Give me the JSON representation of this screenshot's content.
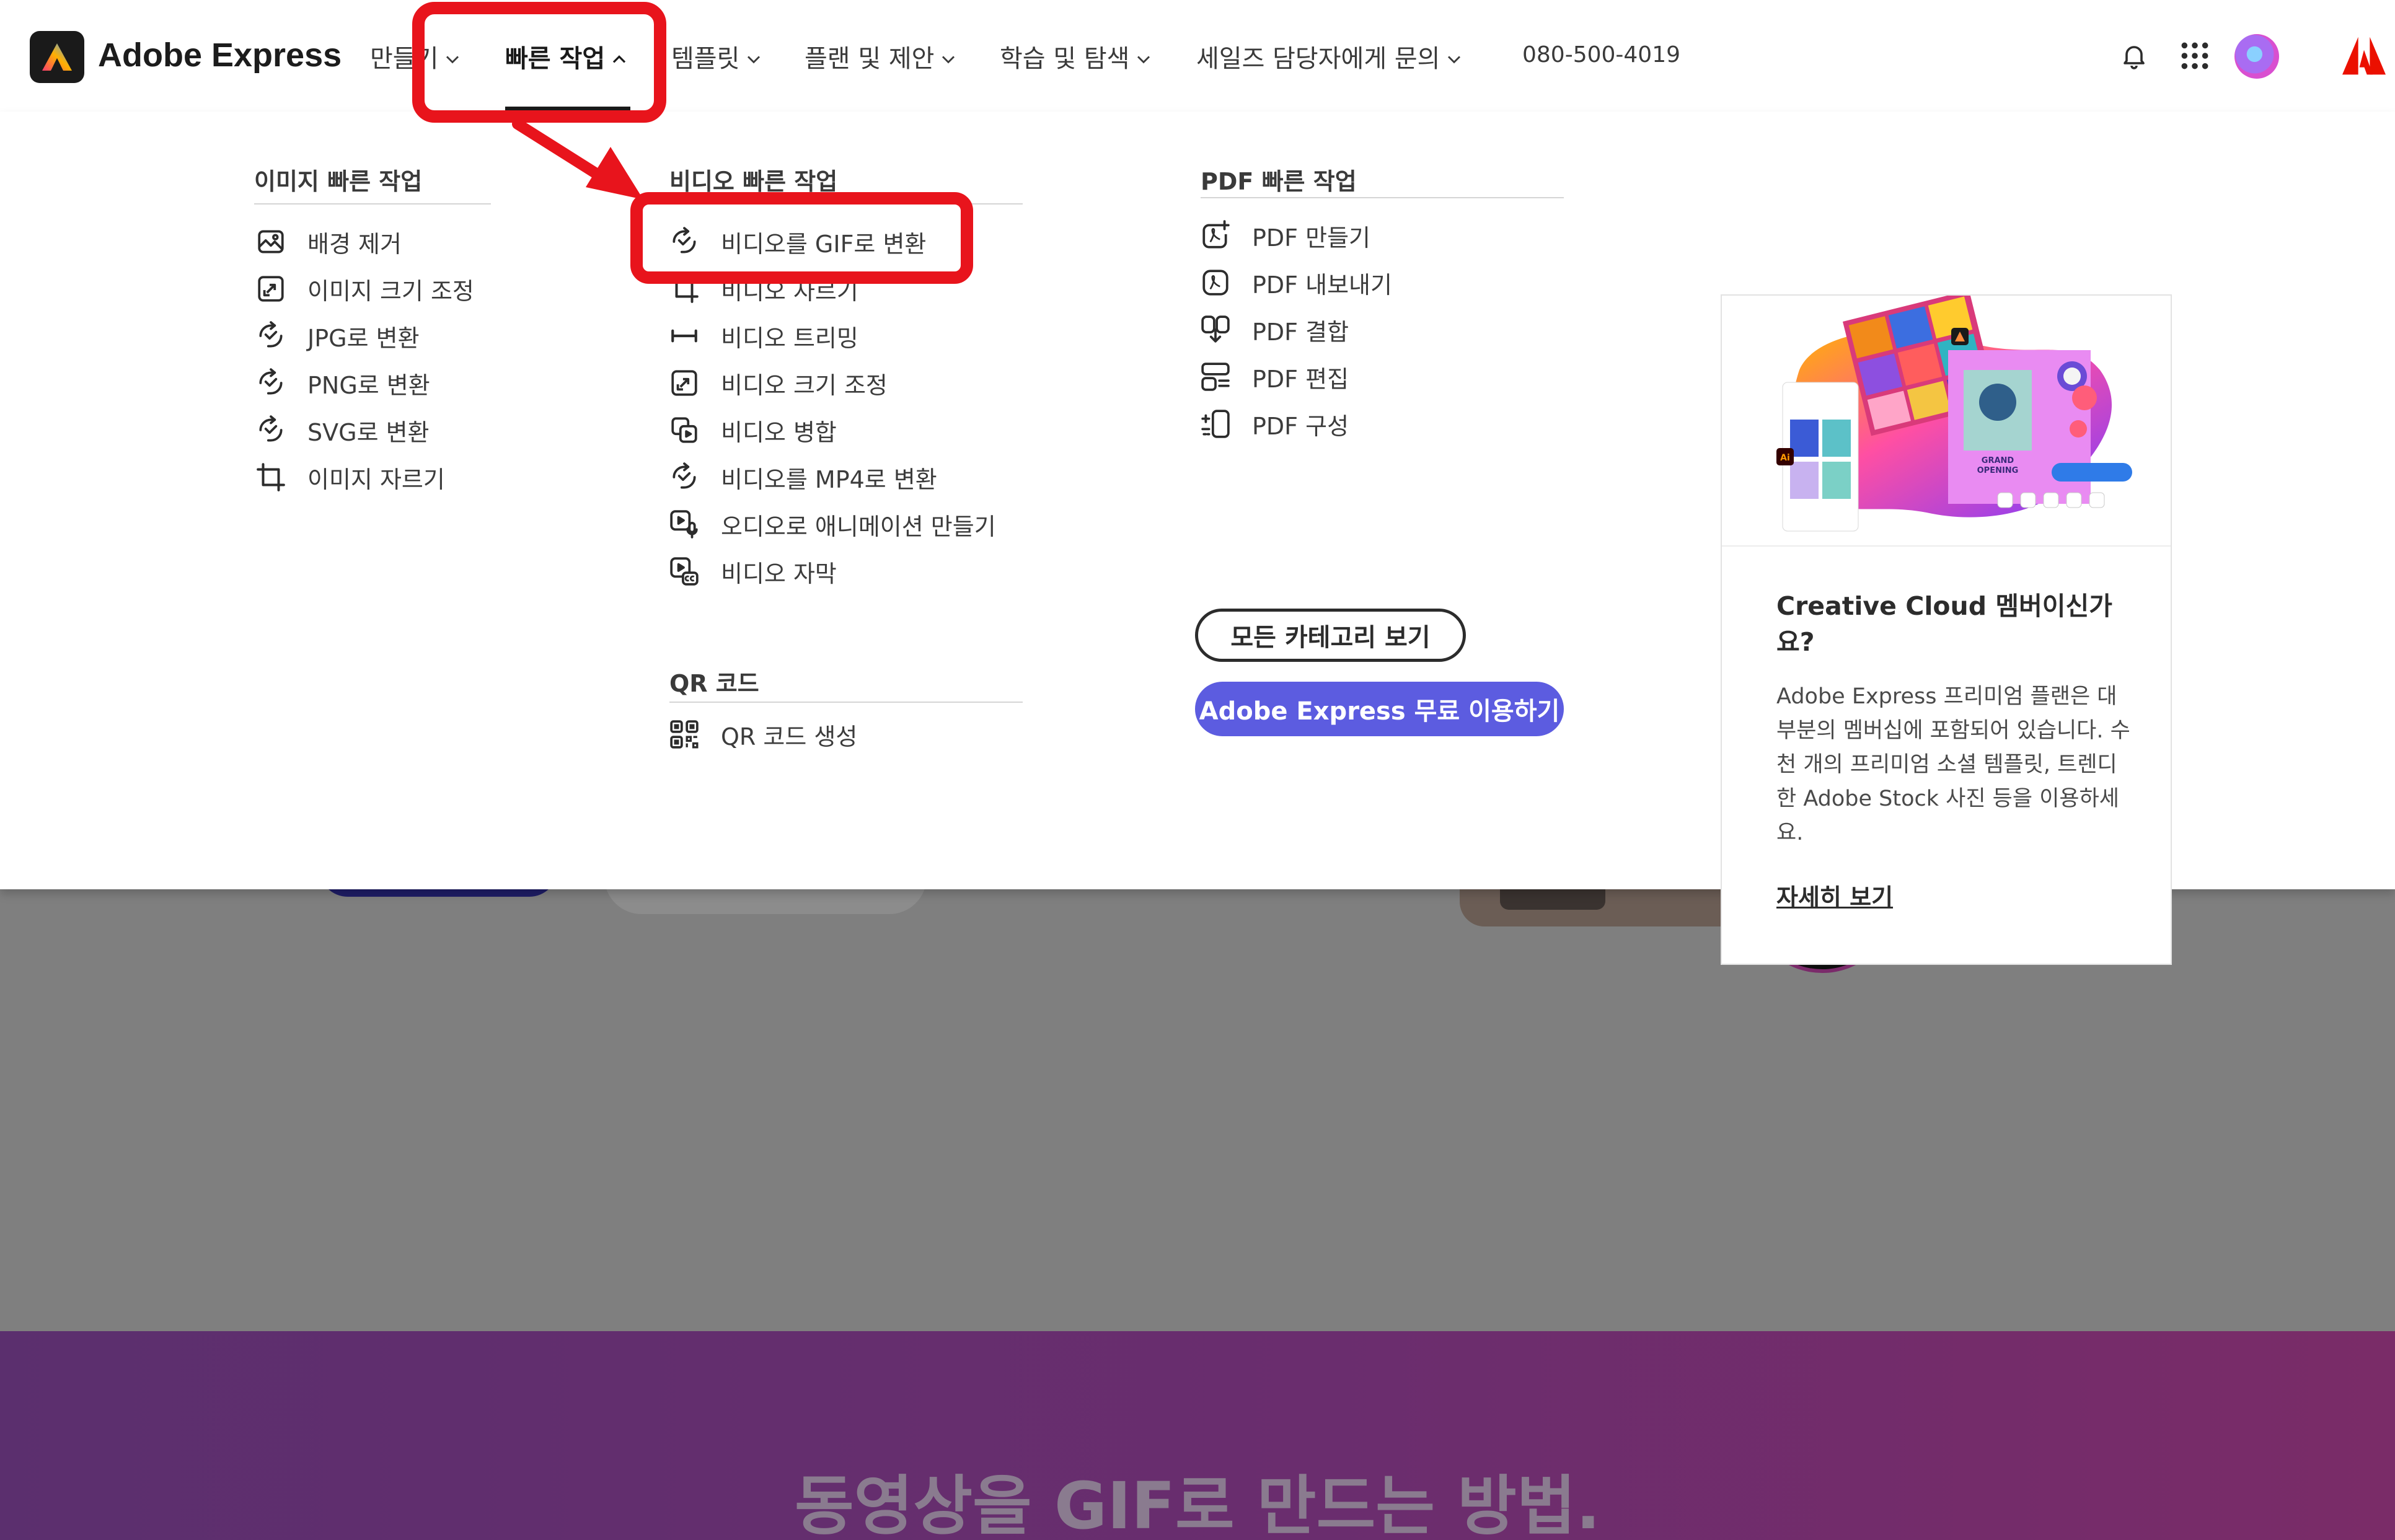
{
  "header": {
    "brand": "Adobe Express",
    "nav": [
      {
        "label": "만들기"
      },
      {
        "label": "빠른 작업"
      },
      {
        "label": "템플릿"
      },
      {
        "label": "플랜 및 제안"
      },
      {
        "label": "학습 및 탐색"
      },
      {
        "label": "세일즈 담당자에게 문의"
      }
    ],
    "phone": "080-500-4019"
  },
  "menu": {
    "image_column": {
      "heading": "이미지 빠른 작업",
      "items": [
        {
          "label": "배경 제거",
          "icon": "image-icon"
        },
        {
          "label": "이미지 크기 조정",
          "icon": "resize-icon"
        },
        {
          "label": "JPG로 변환",
          "icon": "convert-icon"
        },
        {
          "label": "PNG로 변환",
          "icon": "convert-icon"
        },
        {
          "label": "SVG로 변환",
          "icon": "convert-icon"
        },
        {
          "label": "이미지 자르기",
          "icon": "crop-icon"
        }
      ]
    },
    "video_column": {
      "heading": "비디오 빠른 작업",
      "items": [
        {
          "label": "비디오를 GIF로 변환",
          "icon": "convert-icon"
        },
        {
          "label": "비디오 자르기",
          "icon": "crop-icon"
        },
        {
          "label": "비디오 트리밍",
          "icon": "trim-icon"
        },
        {
          "label": "비디오 크기 조정",
          "icon": "resize-icon"
        },
        {
          "label": "비디오 병합",
          "icon": "merge-icon"
        },
        {
          "label": "비디오를 MP4로 변환",
          "icon": "convert-icon"
        },
        {
          "label": "오디오로 애니메이션 만들기",
          "icon": "animate-audio-icon"
        },
        {
          "label": "비디오 자막",
          "icon": "caption-icon"
        }
      ]
    },
    "qr_column": {
      "heading": "QR 코드",
      "items": [
        {
          "label": "QR 코드 생성",
          "icon": "qr-code-icon"
        }
      ]
    },
    "pdf_column": {
      "heading": "PDF 빠른 작업",
      "items": [
        {
          "label": "PDF 만들기",
          "icon": "pdf-create-icon"
        },
        {
          "label": "PDF 내보내기",
          "icon": "pdf-export-icon"
        },
        {
          "label": "PDF 결합",
          "icon": "pdf-combine-icon"
        },
        {
          "label": "PDF 편집",
          "icon": "pdf-edit-icon"
        },
        {
          "label": "PDF 구성",
          "icon": "pdf-organize-icon"
        }
      ]
    },
    "all_categories_label": "모든 카테고리 보기",
    "free_trial_label": "Adobe Express 무료 이용하기",
    "promo": {
      "title": "Creative Cloud 멤버이신가요?",
      "body": "Adobe Express 프리미엄 플랜은 대부분의 멤버십에 포함되어 있습니다. 수천 개의 프리미엄 소셜 템플릿, 트렌디한 Adobe Stock 사진 등을 이용하세요.",
      "link": "자세히 보기"
    }
  },
  "background": {
    "heading": "동영상을 GIF로 만드는 방법."
  },
  "colors": {
    "annotation": "#e8141c",
    "primary_button": "#5c5ce0",
    "adobe_red": "#eb1000",
    "section_purple": "#6a2d6e"
  }
}
